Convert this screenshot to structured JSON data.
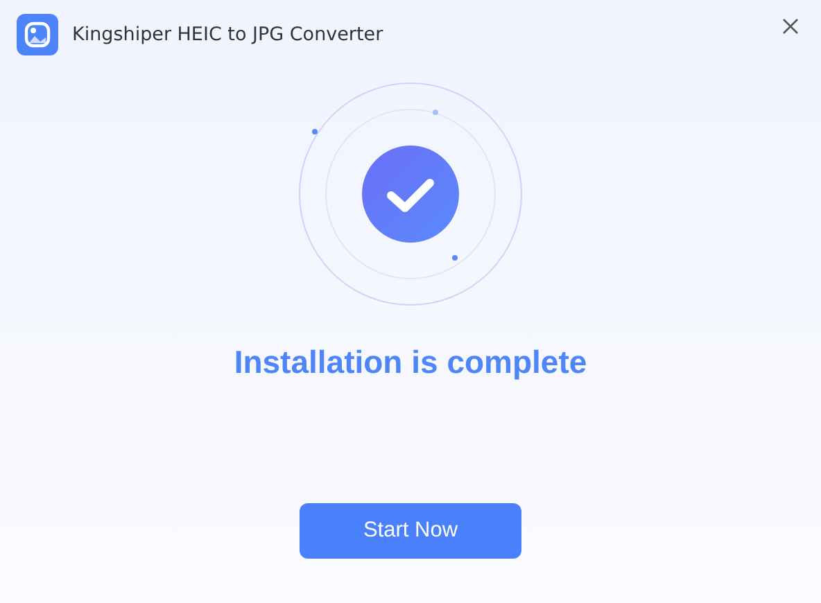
{
  "window": {
    "title": "Kingshiper HEIC to JPG Converter"
  },
  "message": "Installation is complete",
  "button": {
    "label": "Start Now"
  }
}
